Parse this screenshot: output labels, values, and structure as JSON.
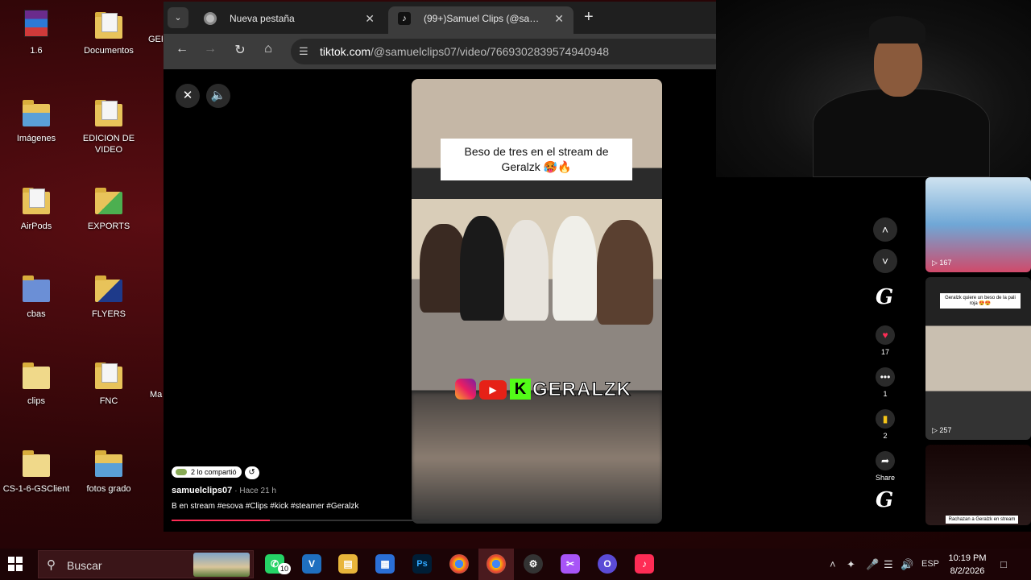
{
  "desktop": {
    "icons": [
      {
        "label": "1.6"
      },
      {
        "label": "Documentos"
      },
      {
        "label": "GER"
      },
      {
        "label": "Imágenes"
      },
      {
        "label": "EDICION DE VIDEO"
      },
      {
        "label": "AirPods"
      },
      {
        "label": "EXPORTS"
      },
      {
        "label": "cbas"
      },
      {
        "label": "FLYERS"
      },
      {
        "label": "clips"
      },
      {
        "label": "FNC"
      },
      {
        "label": "Ma"
      },
      {
        "label": "CS-1-6-GSClient"
      },
      {
        "label": "fotos grado"
      }
    ]
  },
  "browser": {
    "tabs": [
      {
        "title": "Nueva pestaña"
      },
      {
        "title": "(99+)Samuel Clips (@samuelclips07"
      }
    ],
    "address": {
      "host": "tiktok.com",
      "path": "/@samuelclips07/video/7669302839574940948"
    }
  },
  "video": {
    "caption": "Beso de tres en el stream de Geralzk 🥵🔥",
    "brand": "GERALZK",
    "shared_label": "2 lo compartió",
    "author": "samuelclips07",
    "posted_ago": "· Hace 21 h",
    "description": "B          en stream #esova #Clips #kick #steamer #Geralzk",
    "progress_pct": 38
  },
  "actions": {
    "likes": "17",
    "comments": "1",
    "saves": "2",
    "share_label": "Share",
    "like_color": "#fe2c55",
    "save_color": "#f5c518"
  },
  "feed": {
    "thumbs": [
      {
        "views": "167"
      },
      {
        "views": "257",
        "caption": "Geralzk quiere un beso de la pali roja 😍😍"
      },
      {
        "caption": "Rachazan a Geralzk en stream"
      }
    ]
  },
  "taskbar": {
    "search_placeholder": "Buscar",
    "whatsapp_badge": "10",
    "language": "ESP",
    "time": "10:19 PM",
    "date": "8/2/2026"
  }
}
